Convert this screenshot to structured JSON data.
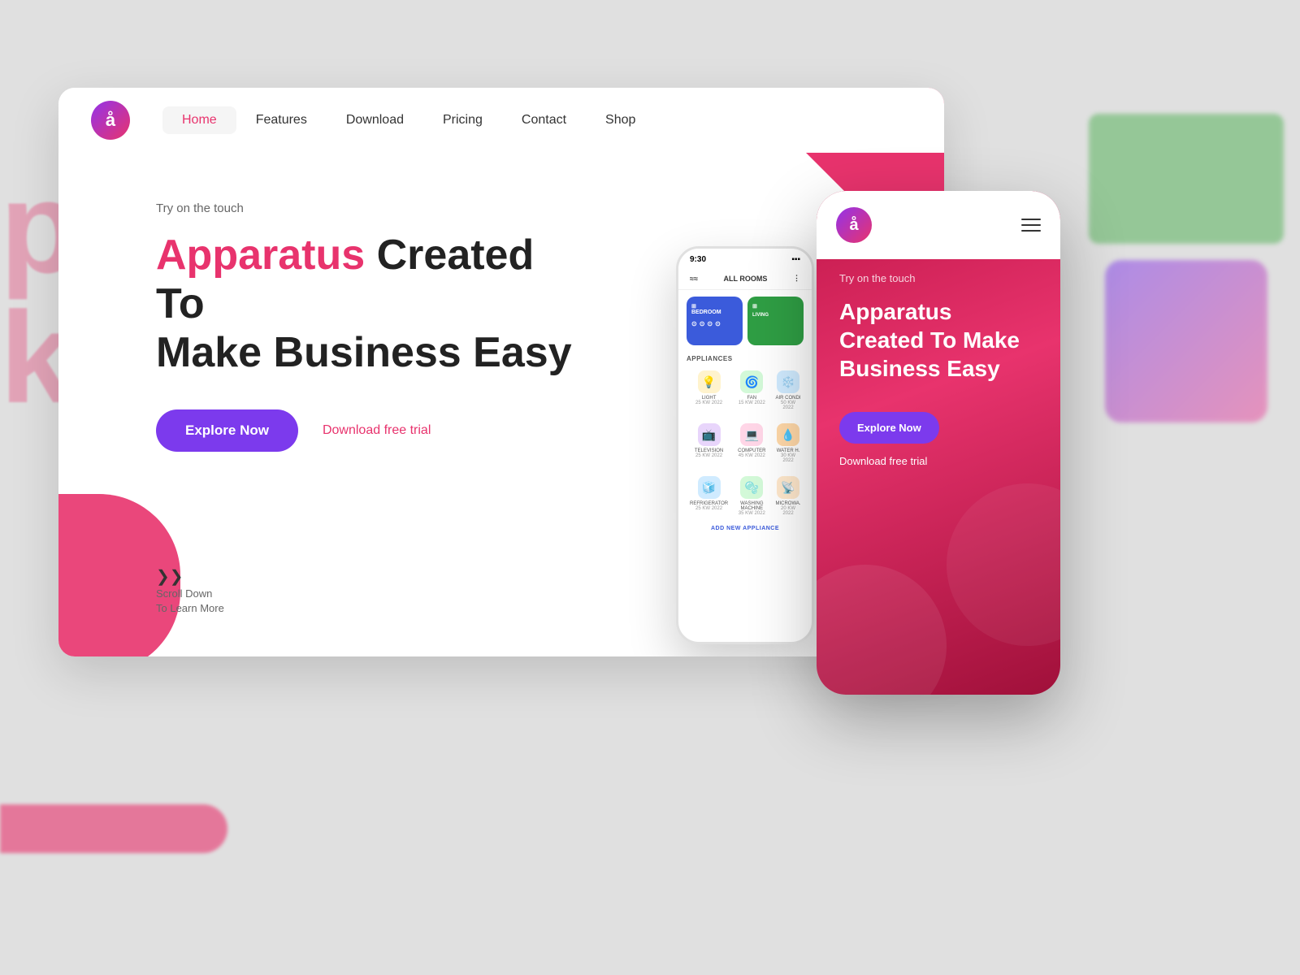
{
  "background": {
    "color": "#e0e0e0"
  },
  "bg_left": {
    "text1": "pa",
    "text2": "ke"
  },
  "navbar": {
    "logo_letter": "å",
    "items": [
      {
        "label": "Home",
        "active": true
      },
      {
        "label": "Features",
        "active": false
      },
      {
        "label": "Download",
        "active": false
      },
      {
        "label": "Pricing",
        "active": false
      },
      {
        "label": "Contact",
        "active": false
      },
      {
        "label": "Shop",
        "active": false
      }
    ]
  },
  "hero": {
    "tagline": "Try on the touch",
    "title_accent": "Apparatus",
    "title_rest": " Created To",
    "title_line2": "Make Business Easy",
    "btn_explore": "Explore Now",
    "btn_trial": "Download free trial"
  },
  "scroll_down": {
    "line1": "Scroll Down",
    "line2": "To Learn More"
  },
  "phone_app": {
    "status_time": "9:30",
    "header_icon": "≈≈",
    "header_label": "ALL ROOMS",
    "room1_label": "BEDROOM",
    "room2_label": "",
    "appliances_section": "APPLIANCES",
    "appliances": [
      {
        "icon": "💡",
        "label": "LIGHT",
        "sub": "25 KW 2022",
        "bg": "#fff3cd"
      },
      {
        "icon": "🌀",
        "label": "FAN",
        "sub": "15 KW 2022",
        "bg": "#d3f9d8"
      },
      {
        "icon": "❄️",
        "label": "AIR CONDI",
        "sub": "50 KW 2022",
        "bg": "#d0ebff"
      },
      {
        "icon": "📺",
        "label": "TELEVISION",
        "sub": "25 KW 2022",
        "bg": "#e8d5fb"
      },
      {
        "icon": "💻",
        "label": "COMPUTER",
        "sub": "45 KW 2022",
        "bg": "#ffd6e7"
      },
      {
        "icon": "💧",
        "label": "WATER H.",
        "sub": "30 KW 2022",
        "bg": "#ffd8a8"
      },
      {
        "icon": "🧊",
        "label": "REFRIGERATOR",
        "sub": "25 KW 2022",
        "bg": "#d0ebff"
      },
      {
        "icon": "🫧",
        "label": "WASHING MACHINE",
        "sub": "35 KW 2022",
        "bg": "#d3f9d8"
      },
      {
        "icon": "📡",
        "label": "MICROWA.",
        "sub": "20 KW 2022",
        "bg": "#ffe8cc"
      }
    ],
    "add_label": "ADD NEW APPLIANCE"
  },
  "mobile": {
    "logo_letter": "å",
    "tagline": "Try on the touch",
    "title": "Apparatus Created To Make Business Easy",
    "btn_explore": "Explore Now",
    "btn_trial": "Download free trial"
  }
}
